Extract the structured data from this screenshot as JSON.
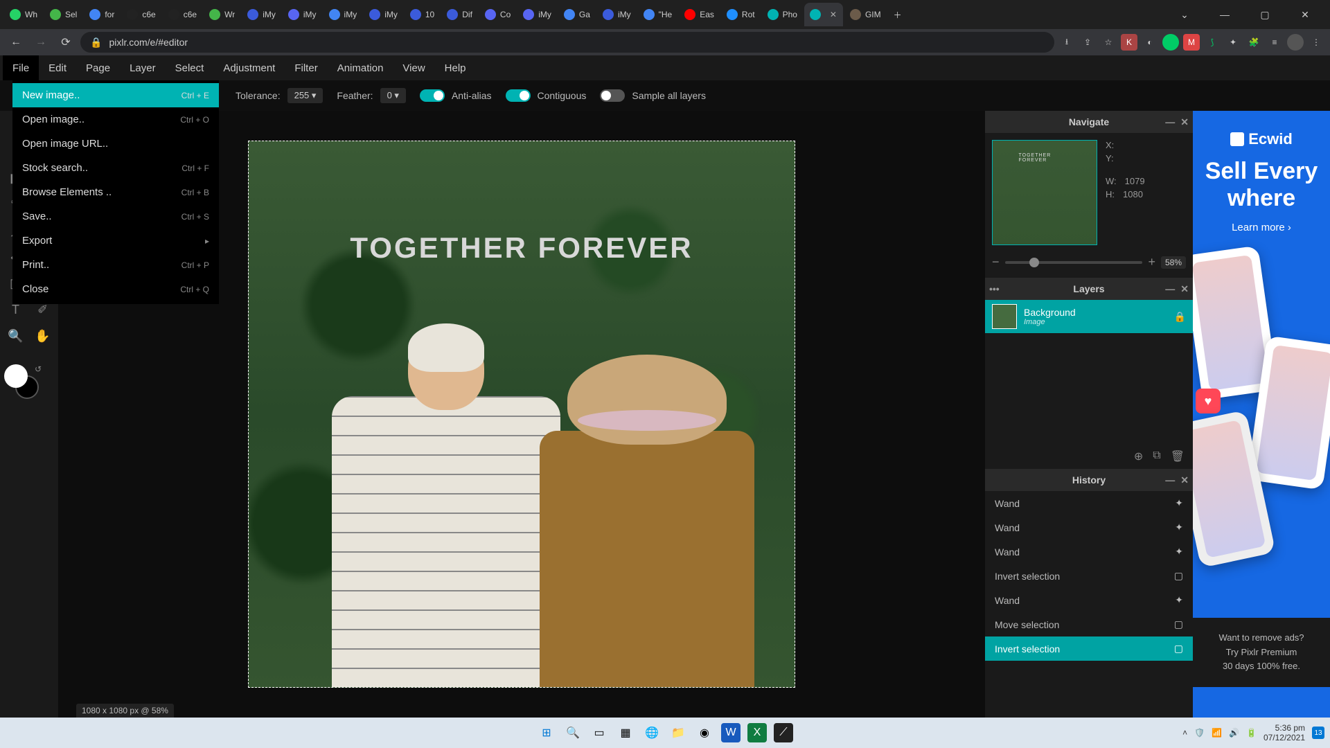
{
  "browser": {
    "tabs": [
      {
        "label": "Wh",
        "color": "#25D366"
      },
      {
        "label": "Sel",
        "color": "#44b549"
      },
      {
        "label": "for",
        "color": "#4285F4"
      },
      {
        "label": "c6e",
        "color": "#222"
      },
      {
        "label": "c6e",
        "color": "#222"
      },
      {
        "label": "Wr",
        "color": "#44b549"
      },
      {
        "label": "iMy",
        "color": "#3b5bdb"
      },
      {
        "label": "iMy",
        "color": "#5865F2"
      },
      {
        "label": "iMy",
        "color": "#4285F4"
      },
      {
        "label": "iMy",
        "color": "#3b5bdb"
      },
      {
        "label": "10",
        "color": "#3b5bdb"
      },
      {
        "label": "Dif",
        "color": "#3b5bdb"
      },
      {
        "label": "Co",
        "color": "#5865F2"
      },
      {
        "label": "iMy",
        "color": "#5865F2"
      },
      {
        "label": "Ga",
        "color": "#4285F4"
      },
      {
        "label": "iMy",
        "color": "#3b5bdb"
      },
      {
        "label": "\"He",
        "color": "#4285F4"
      },
      {
        "label": "Eas",
        "color": "#FF0000"
      },
      {
        "label": "Rot",
        "color": "#1f8fff"
      },
      {
        "label": "Pho",
        "color": "#00b3b3"
      },
      {
        "label": "",
        "color": "#00b3b3",
        "active": true,
        "close": true
      },
      {
        "label": "GIM",
        "color": "#6b5b4a"
      }
    ],
    "url": "pixlr.com/e/#editor"
  },
  "menubar": [
    "File",
    "Edit",
    "Page",
    "Layer",
    "Select",
    "Adjustment",
    "Filter",
    "Animation",
    "View",
    "Help"
  ],
  "fileMenu": [
    {
      "label": "New image..",
      "shortcut": "Ctrl + E",
      "hover": true
    },
    {
      "label": "Open image..",
      "shortcut": "Ctrl + O"
    },
    {
      "label": "Open image URL..",
      "shortcut": ""
    },
    {
      "label": "Stock search..",
      "shortcut": "Ctrl + F"
    },
    {
      "label": "Browse Elements ..",
      "shortcut": "Ctrl + B"
    },
    {
      "label": "Save..",
      "shortcut": "Ctrl + S"
    },
    {
      "label": "Export",
      "shortcut": "▸"
    },
    {
      "label": "Print..",
      "shortcut": "Ctrl + P"
    },
    {
      "label": "Close",
      "shortcut": "Ctrl + Q"
    }
  ],
  "options": {
    "toleranceLabel": "Tolerance:",
    "toleranceValue": "255 ▾",
    "featherLabel": "Feather:",
    "featherValue": "0 ▾",
    "antiAlias": "Anti-alias",
    "contiguous": "Contiguous",
    "sampleAll": "Sample all layers"
  },
  "canvas": {
    "title": "TOGETHER FOREVER",
    "status": "1080 x 1080 px @ 58%"
  },
  "navigate": {
    "title": "Navigate",
    "xLabel": "X:",
    "yLabel": "Y:",
    "wLabel": "W:",
    "wValue": "1079",
    "hLabel": "H:",
    "hValue": "1080",
    "zoom": "58%"
  },
  "layers": {
    "title": "Layers",
    "name": "Background",
    "type": "Image"
  },
  "history": {
    "title": "History",
    "items": [
      {
        "label": "Wand",
        "icon": "✦"
      },
      {
        "label": "Wand",
        "icon": "✦"
      },
      {
        "label": "Wand",
        "icon": "✦"
      },
      {
        "label": "Invert selection",
        "icon": "▢"
      },
      {
        "label": "Wand",
        "icon": "✦"
      },
      {
        "label": "Move selection",
        "icon": "▢"
      },
      {
        "label": "Invert selection",
        "icon": "▢",
        "active": true
      }
    ]
  },
  "ad": {
    "brand": "Ecwid",
    "headline": "Sell Every where",
    "cta": "Learn more ›",
    "footer1": "Want to remove ads?",
    "footer2": "Try Pixlr Premium",
    "footer3": "30 days 100% free."
  },
  "clock": {
    "time": "5:36 pm",
    "date": "07/12/2021",
    "notif": "13"
  }
}
